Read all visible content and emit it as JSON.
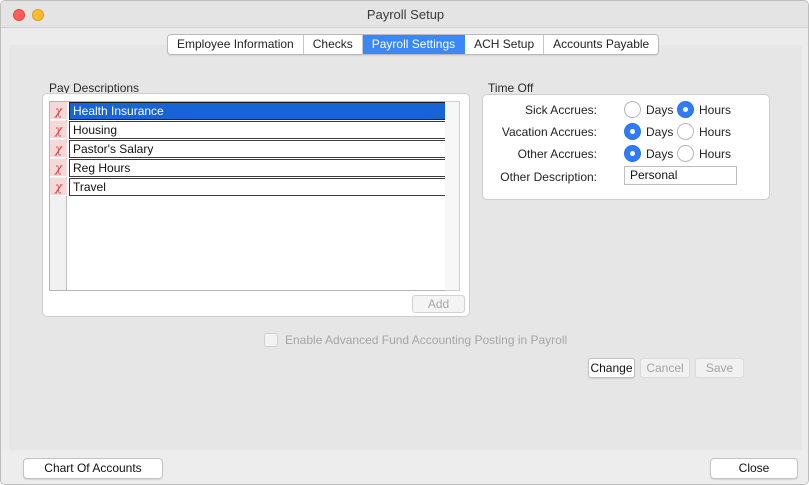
{
  "window": {
    "title": "Payroll Setup"
  },
  "tabs": [
    {
      "label": "Employee Information",
      "active": false
    },
    {
      "label": "Checks",
      "active": false
    },
    {
      "label": "Payroll Settings",
      "active": true
    },
    {
      "label": "ACH Setup",
      "active": false
    },
    {
      "label": "Accounts Payable",
      "active": false
    }
  ],
  "pay_descriptions": {
    "header": "Pay Descriptions",
    "delete_glyph": "χ",
    "items": [
      {
        "label": "Health Insurance",
        "selected": true
      },
      {
        "label": "Housing",
        "selected": false
      },
      {
        "label": "Pastor's Salary",
        "selected": false
      },
      {
        "label": "Reg Hours",
        "selected": false
      },
      {
        "label": "Travel",
        "selected": false
      }
    ],
    "add_label": "Add"
  },
  "time_off": {
    "header": "Time Off",
    "rows": [
      {
        "label": "Sick Accrues:",
        "option_a": "Days",
        "option_b": "Hours",
        "selected": "Hours"
      },
      {
        "label": "Vacation Accrues:",
        "option_a": "Days",
        "option_b": "Hours",
        "selected": "Days"
      },
      {
        "label": "Other Accrues:",
        "option_a": "Days",
        "option_b": "Hours",
        "selected": "Days"
      }
    ],
    "other_description_label": "Other Description:",
    "other_description_value": "Personal"
  },
  "fund_accounting": {
    "label": "Enable Advanced Fund Accounting Posting in Payroll",
    "checked": false,
    "enabled": false
  },
  "actions": {
    "change": "Change",
    "cancel": "Cancel",
    "save": "Save"
  },
  "footer": {
    "chart_of_accounts": "Chart Of Accounts",
    "close": "Close"
  },
  "colors": {
    "accent": "#3a88f6",
    "selection": "#1665d8",
    "delete": "#cf3e3e"
  }
}
